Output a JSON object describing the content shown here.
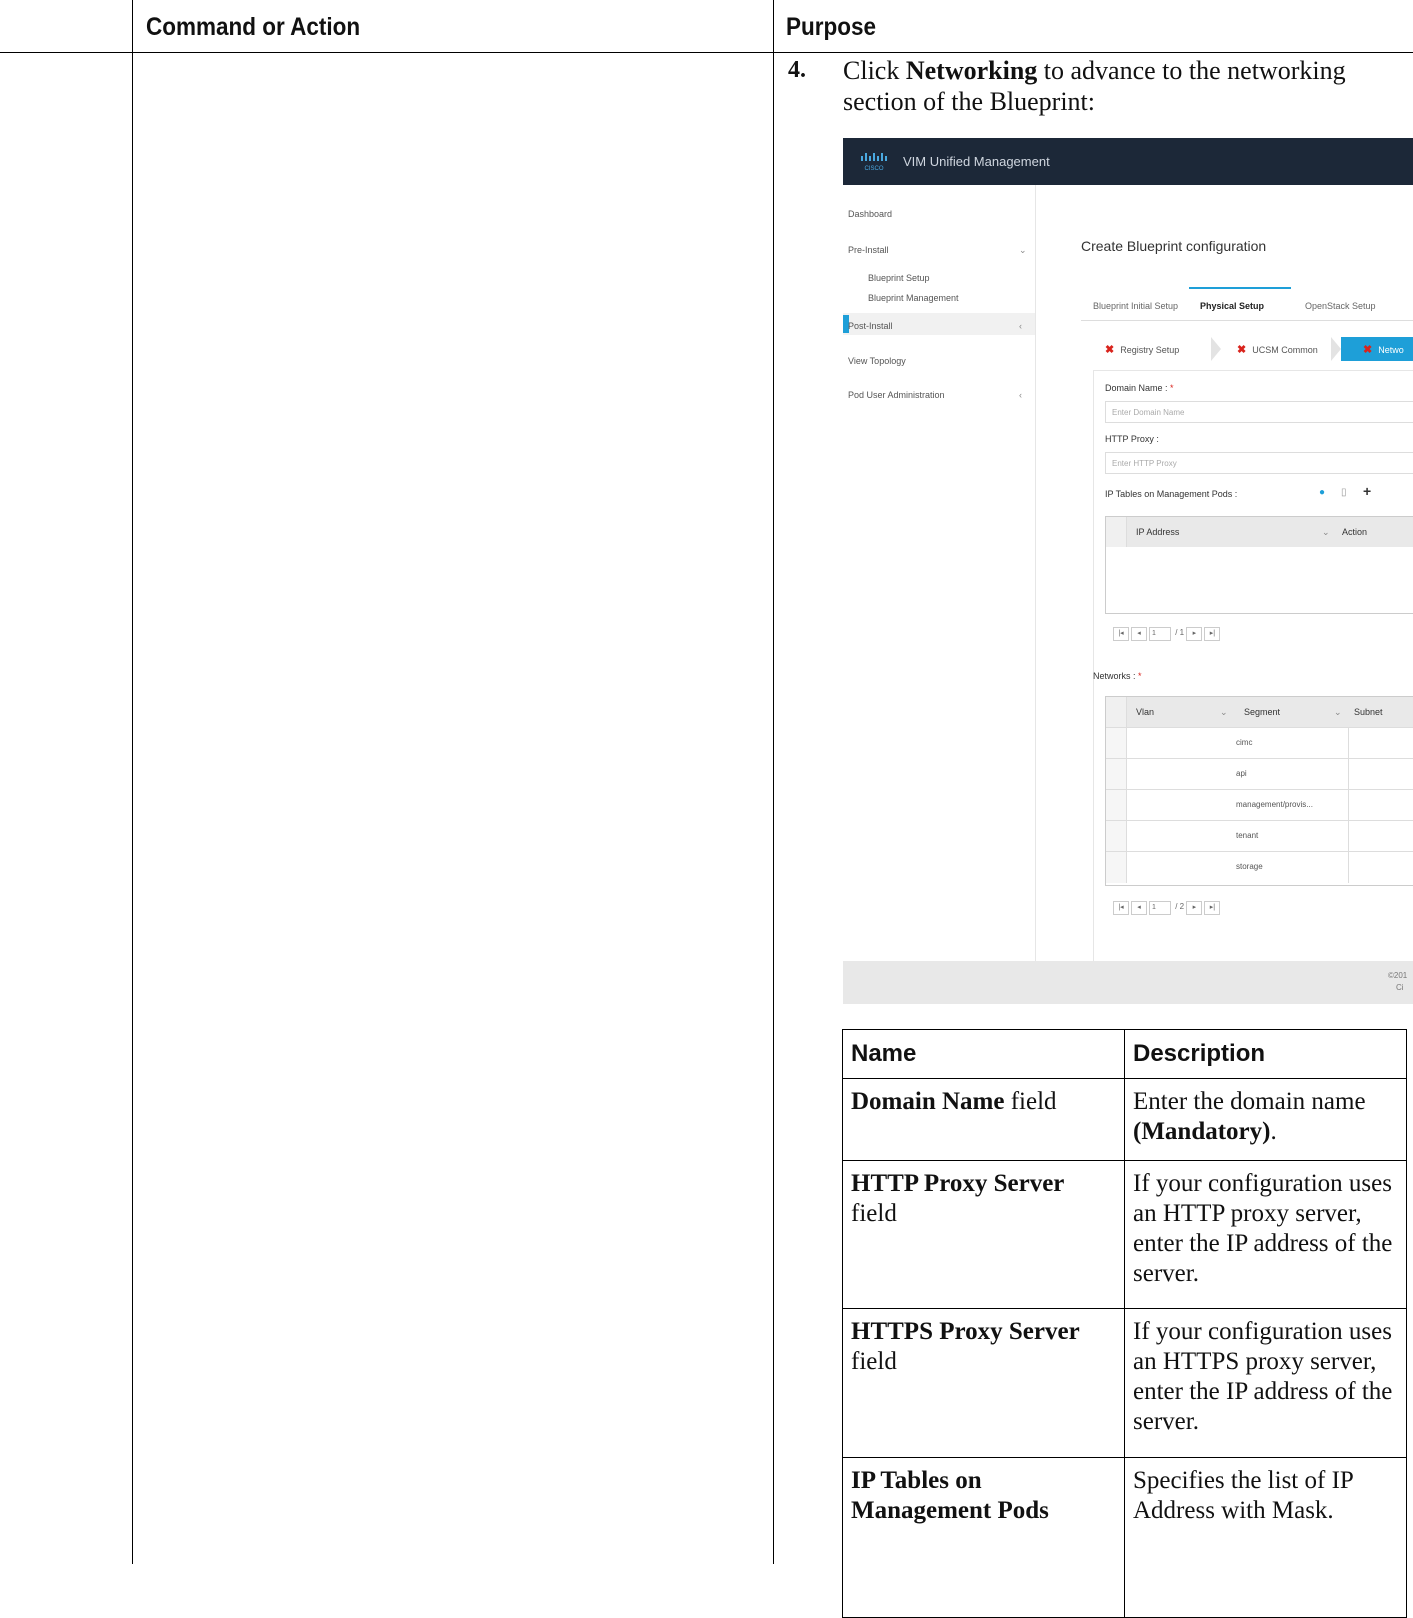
{
  "columns": {
    "command": "Command or Action",
    "purpose": "Purpose"
  },
  "step": {
    "number": "4.",
    "pre": "Click ",
    "bold": "Networking",
    "post": " to advance to the networking section of the Blueprint:"
  },
  "screenshot": {
    "app_title": "VIM Unified Management",
    "sidebar": {
      "dashboard": "Dashboard",
      "pre_install": "Pre-Install",
      "blueprint_setup": "Blueprint Setup",
      "blueprint_management": "Blueprint Management",
      "post_install": "Post-Install",
      "view_topology": "View Topology",
      "pod_user_admin": "Pod User Administration"
    },
    "page_title": "Create Blueprint configuration",
    "tabs": [
      "Blueprint Initial Setup",
      "Physical Setup",
      "OpenStack Setup"
    ],
    "steps": [
      "Registry Setup",
      "UCSM Common",
      "Netwo"
    ],
    "domain_label": "Domain Name :",
    "domain_placeholder": "Enter Domain Name",
    "proxy_label": "HTTP Proxy :",
    "proxy_placeholder": "Enter HTTP Proxy",
    "iptables_label": "IP Tables on Management Pods :",
    "ip_grid_headers": [
      "IP Address",
      "Action"
    ],
    "pager1": {
      "page": "1",
      "of": "/ 1"
    },
    "networks_label": "Networks :",
    "net_headers": [
      "Vlan",
      "Segment",
      "Subnet"
    ],
    "segments": [
      "cimc",
      "api",
      "management/provis...",
      "tenant",
      "storage"
    ],
    "pager2": {
      "page": "1",
      "of": "/ 2"
    },
    "footer": [
      "©201",
      "Ci"
    ]
  },
  "desc_table": {
    "headers": [
      "Name",
      "Description"
    ],
    "rows": [
      {
        "name_b": "Domain Name",
        "name_t": " field",
        "desc_t": "Enter the domain name ",
        "desc_b": "(Mandatory)",
        "desc_end": "."
      },
      {
        "name_b": "HTTP Proxy Server",
        "name_t": " field",
        "desc_t": "If your configuration uses an HTTP proxy server, enter the IP address of the server.",
        "desc_b": "",
        "desc_end": ""
      },
      {
        "name_b": "HTTPS Proxy Server",
        "name_t": " field",
        "desc_t": "If your configuration uses an HTTPS proxy server, enter the IP address of the server.",
        "desc_b": "",
        "desc_end": ""
      },
      {
        "name_b": "IP Tables on Management Pods",
        "name_t": "",
        "desc_t": "Specifies the list of IP Address with Mask.",
        "desc_b": "",
        "desc_end": ""
      }
    ]
  }
}
